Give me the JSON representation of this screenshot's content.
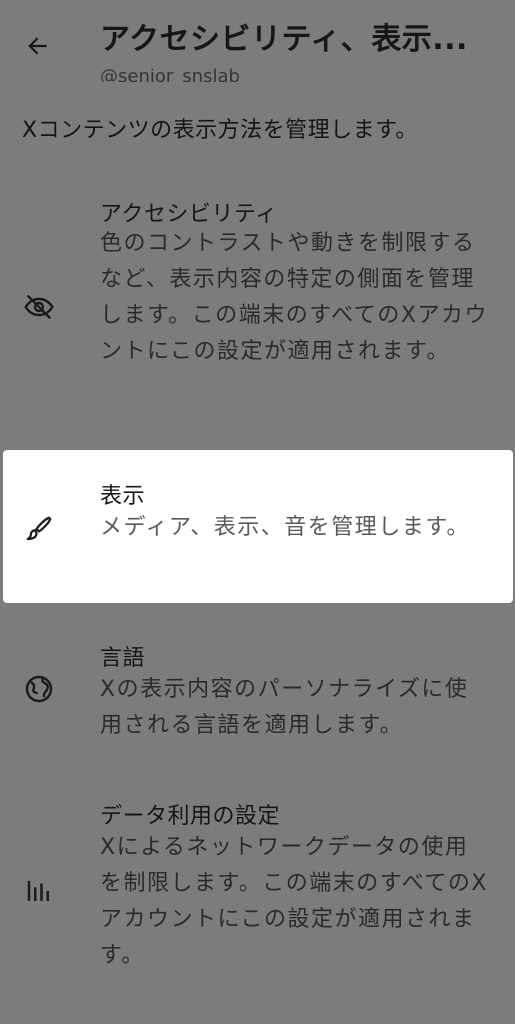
{
  "header": {
    "title": "アクセシビリティ、表示...",
    "subtitle": "@senior_snslab"
  },
  "intro": "Xコンテンツの表示方法を管理します。",
  "items": [
    {
      "title": "アクセシビリティ",
      "description": "色のコントラストや動きを制限するなど、表示内容の特定の側面を管理します。この端末のすべてのXアカウントにこの設定が適用されます。",
      "icon": "eye-slash-icon"
    },
    {
      "title": "表示",
      "description": "メディア、表示、音を管理します。",
      "icon": "brush-icon"
    },
    {
      "title": "言語",
      "description": "Xの表示内容のパーソナライズに使用される言語を適用します。",
      "icon": "globe-icon"
    },
    {
      "title": "データ利用の設定",
      "description": "Xによるネットワークデータの使用を制限します。この端末のすべてのXアカウントにこの設定が適用されます。",
      "icon": "bar-chart-icon"
    }
  ]
}
